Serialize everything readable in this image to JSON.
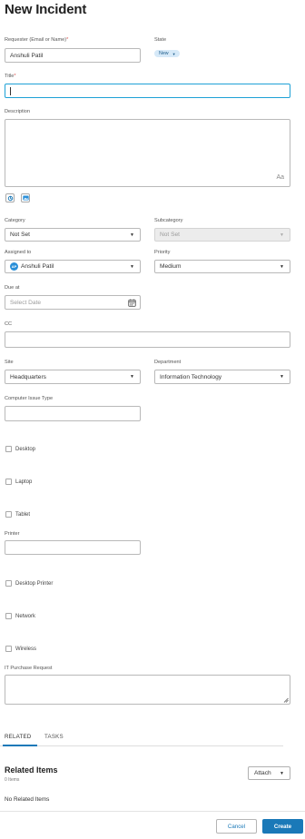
{
  "page": {
    "title": "New Incident"
  },
  "requester": {
    "label": "Requester (Email or Name)",
    "required_mark": "*",
    "value": "Anshuli Patil"
  },
  "state": {
    "label": "State",
    "value": "New"
  },
  "title_field": {
    "label": "Title",
    "required_mark": "*",
    "value": ""
  },
  "description": {
    "label": "Description",
    "value": "",
    "font_badge": "Aa"
  },
  "category": {
    "label": "Category",
    "value": "Not Set"
  },
  "subcategory": {
    "label": "Subcategory",
    "value": "Not Set"
  },
  "assigned_to": {
    "label": "Assigned to",
    "avatar_initials": "AP",
    "value": "Anshuli Patil"
  },
  "priority": {
    "label": "Priority",
    "value": "Medium"
  },
  "due_at": {
    "label": "Due at",
    "placeholder": "Select Date"
  },
  "cc": {
    "label": "CC",
    "value": ""
  },
  "site": {
    "label": "Site",
    "value": "Headquarters"
  },
  "department": {
    "label": "Department",
    "value": "Information Technology"
  },
  "computer_issue_type": {
    "label": "Computer Issue Type",
    "value": ""
  },
  "checkboxes_a": [
    "Desktop",
    "Laptop",
    "Tablet"
  ],
  "printer": {
    "label": "Printer",
    "value": ""
  },
  "checkboxes_b": [
    "Desktop Printer",
    "Network",
    "Wireless"
  ],
  "it_purchase": {
    "label": "IT Purchase Request",
    "value": ""
  },
  "tabs": [
    {
      "label": "RELATED",
      "active": true
    },
    {
      "label": "TASKS",
      "active": false
    }
  ],
  "related": {
    "title": "Related Items",
    "count": "0 Items",
    "attach_label": "Attach",
    "empty_text": "No Related Items"
  },
  "footer": {
    "cancel_label": "Cancel",
    "create_label": "Create"
  },
  "colors": {
    "accent": "#1a79b8",
    "focus": "#1ea1d6",
    "badge_bg": "#d6e9f8"
  }
}
